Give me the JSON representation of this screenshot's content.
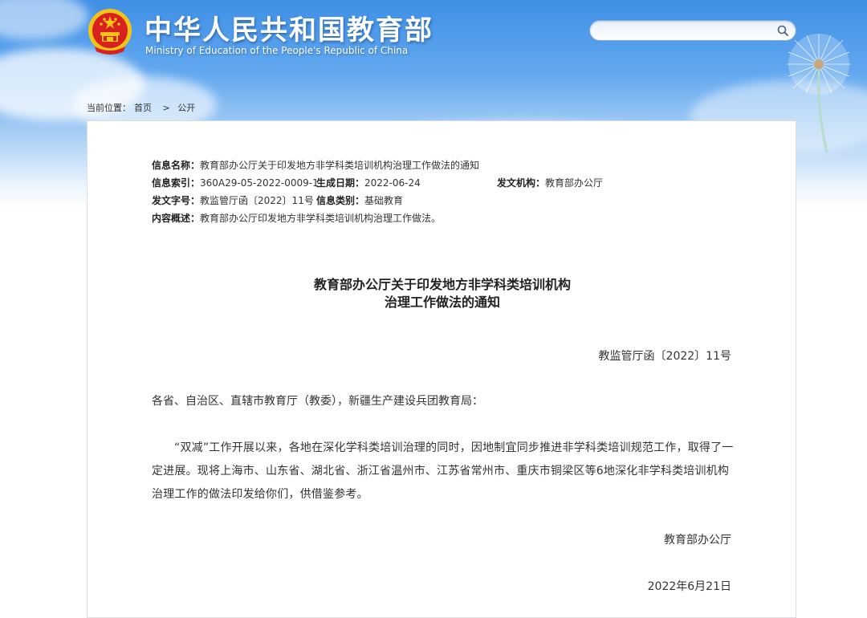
{
  "header": {
    "site_title": "中华人民共和国教育部",
    "site_subtitle": "Ministry of Education of the People's Republic of China",
    "search_placeholder": ""
  },
  "breadcrumb": {
    "prefix": "当前位置：",
    "items": [
      "首页",
      "公开"
    ],
    "separator": ">"
  },
  "meta": {
    "name_label": "信息名称：",
    "name_value": "教育部办公厅关于印发地方非学科类培训机构治理工作做法的通知",
    "index_label": "信息索引：",
    "index_value": "360A29-05-2022-0009-1",
    "date_label": "生成日期：",
    "date_value": "2022-06-24",
    "org_label": "发文机构：",
    "org_value": "教育部办公厅",
    "docno_label": "发文字号：",
    "docno_value": "教监管厅函〔2022〕11号",
    "category_label": "信息类别：",
    "category_value": "基础教育",
    "summary_label": "内容概述：",
    "summary_value": "教育部办公厅印发地方非学科类培训机构治理工作做法。"
  },
  "document": {
    "title_line1": "教育部办公厅关于印发地方非学科类培训机构",
    "title_line2": "治理工作做法的通知",
    "number": "教监管厅函〔2022〕11号",
    "salutation": "各省、自治区、直辖市教育厅（教委），新疆生产建设兵团教育局：",
    "body": "“双减”工作开展以来，各地在深化学科类培训治理的同时，因地制宜同步推进非学科类培训规范工作，取得了一定进展。现将上海市、山东省、湖北省、浙江省温州市、江苏省常州市、重庆市铜梁区等6地深化非学科类培训机构治理工作的做法印发给你们，供借鉴参考。",
    "signature": "教育部办公厅",
    "date": "2022年6月21日"
  },
  "colors": {
    "sky_top": "#3f8fe6",
    "emblem_red": "#d7201f",
    "emblem_gold": "#f3c316"
  },
  "icons": [
    "national-emblem-icon",
    "search-icon",
    "dandelion-decoration"
  ]
}
